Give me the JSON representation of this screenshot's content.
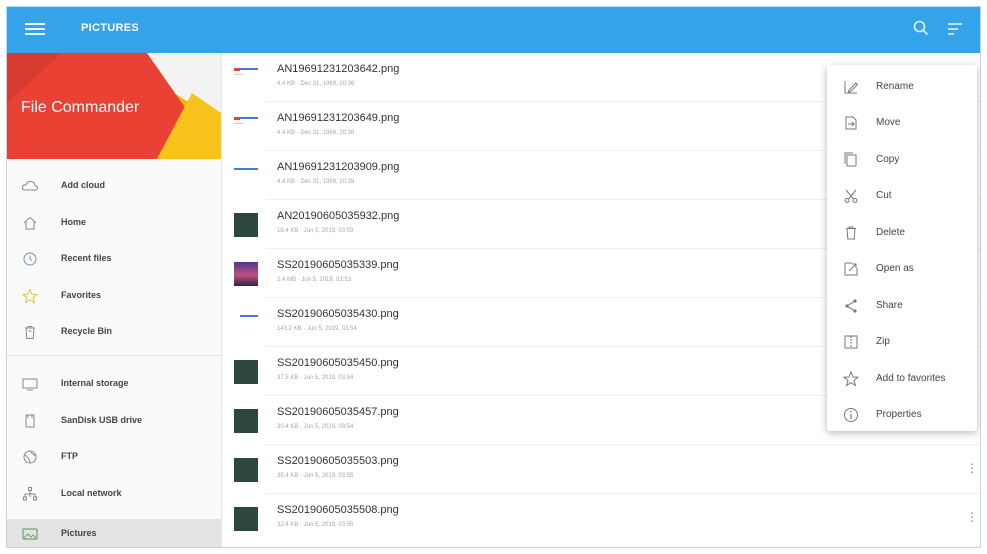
{
  "appbar": {
    "title": "PICTURES",
    "icons": [
      "menu-icon",
      "search-icon",
      "sort-icon"
    ],
    "color": "#35a3ea"
  },
  "sidebar": {
    "brand": "File Commander",
    "items": [
      {
        "label": "Add cloud",
        "icon": "cloud-icon"
      },
      {
        "label": "Home",
        "icon": "home-icon"
      },
      {
        "label": "Recent files",
        "icon": "clock-icon"
      },
      {
        "label": "Favorites",
        "icon": "star-icon"
      },
      {
        "label": "Recycle Bin",
        "icon": "trash-icon"
      },
      {
        "label": "Internal storage",
        "icon": "storage-icon"
      },
      {
        "label": "SanDisk USB drive",
        "icon": "usb-icon"
      },
      {
        "label": "FTP",
        "icon": "ftp-icon"
      },
      {
        "label": "Local network",
        "icon": "network-icon"
      },
      {
        "label": "Pictures",
        "icon": "pictures-icon",
        "active": true
      }
    ]
  },
  "files": [
    {
      "name": "AN19691231203642.png",
      "meta": "4.4 KB · Dec 31, 1969, 20:36"
    },
    {
      "name": "AN19691231203649.png",
      "meta": "4.4 KB · Dec 31, 1969, 20:36"
    },
    {
      "name": "AN19691231203909.png",
      "meta": "4.4 KB · Dec 31, 1969, 20:39"
    },
    {
      "name": "AN20190605035932.png",
      "meta": "18.4 KB · Jun 5, 2019, 03:59"
    },
    {
      "name": "SS20190605035339.png",
      "meta": "2.4 MB · Jun 5, 2019, 03:53"
    },
    {
      "name": "SS20190605035430.png",
      "meta": "143.2 KB · Jun 5, 2019, 03:54"
    },
    {
      "name": "SS20190605035450.png",
      "meta": "37.5 KB · Jun 5, 2019, 03:54"
    },
    {
      "name": "SS20190605035457.png",
      "meta": "30.4 KB · Jun 5, 2019, 03:54"
    },
    {
      "name": "SS20190605035503.png",
      "meta": "35.4 KB · Jun 5, 2019, 03:55"
    },
    {
      "name": "SS20190605035508.png",
      "meta": "32.4 KB · Jun 5, 2019, 03:55"
    }
  ],
  "context_menu": {
    "items": [
      {
        "label": "Rename",
        "icon": "rename-icon"
      },
      {
        "label": "Move",
        "icon": "move-icon"
      },
      {
        "label": "Copy",
        "icon": "copy-icon"
      },
      {
        "label": "Cut",
        "icon": "cut-icon"
      },
      {
        "label": "Delete",
        "icon": "delete-icon"
      },
      {
        "label": "Open as",
        "icon": "open-as-icon"
      },
      {
        "label": "Share",
        "icon": "share-icon"
      },
      {
        "label": "Zip",
        "icon": "zip-icon"
      },
      {
        "label": "Add to favorites",
        "icon": "star-icon"
      },
      {
        "label": "Properties",
        "icon": "info-icon"
      }
    ]
  }
}
